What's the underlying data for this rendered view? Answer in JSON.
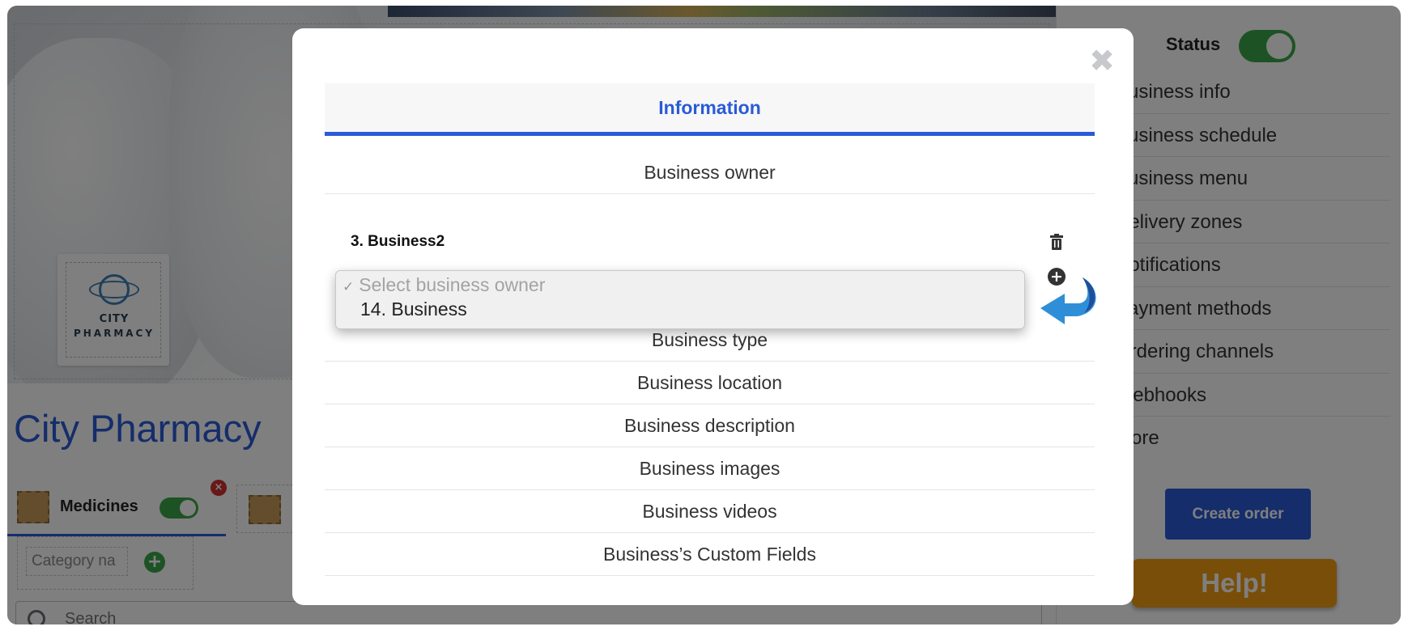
{
  "store": {
    "name": "City Pharmacy",
    "logo_line1": "CITY",
    "logo_line2": "PHARMACY"
  },
  "categories": {
    "active": {
      "name": "Medicines",
      "enabled": true
    },
    "new_category_placeholder": "Category na"
  },
  "search": {
    "placeholder": "Search"
  },
  "sidebar": {
    "status_label": "Status",
    "status_enabled": true,
    "items": [
      {
        "label": "Business info"
      },
      {
        "label": "Business schedule"
      },
      {
        "label": "Business menu"
      },
      {
        "label": "Delivery zones"
      },
      {
        "label": "Notifications"
      },
      {
        "label": "Payment methods"
      },
      {
        "label": "Ordering channels"
      },
      {
        "label": "Webhooks"
      },
      {
        "label": "More"
      }
    ],
    "create_order_label": "Create order",
    "help_label": "Help!"
  },
  "modal": {
    "tab_label": "Information",
    "owner_section_label": "Business owner",
    "owner_name": "3. Business2",
    "dropdown": {
      "options": [
        "Select business owner",
        "14. Business"
      ],
      "selected": "Select business owner"
    },
    "rows": [
      {
        "label": "Business type"
      },
      {
        "label": "Business location"
      },
      {
        "label": "Business description"
      },
      {
        "label": "Business images"
      },
      {
        "label": "Business videos"
      },
      {
        "label": "Business’s Custom Fields"
      }
    ]
  },
  "colors": {
    "accent": "#2a5bd7",
    "toggle_on": "#3aa648",
    "help": "#f39c12",
    "danger": "#d0302f"
  },
  "icons": [
    "close-icon",
    "trash-icon",
    "add-circle-icon",
    "curved-arrow-icon",
    "search-icon",
    "delete-category-icon",
    "add-category-icon",
    "check-icon"
  ]
}
